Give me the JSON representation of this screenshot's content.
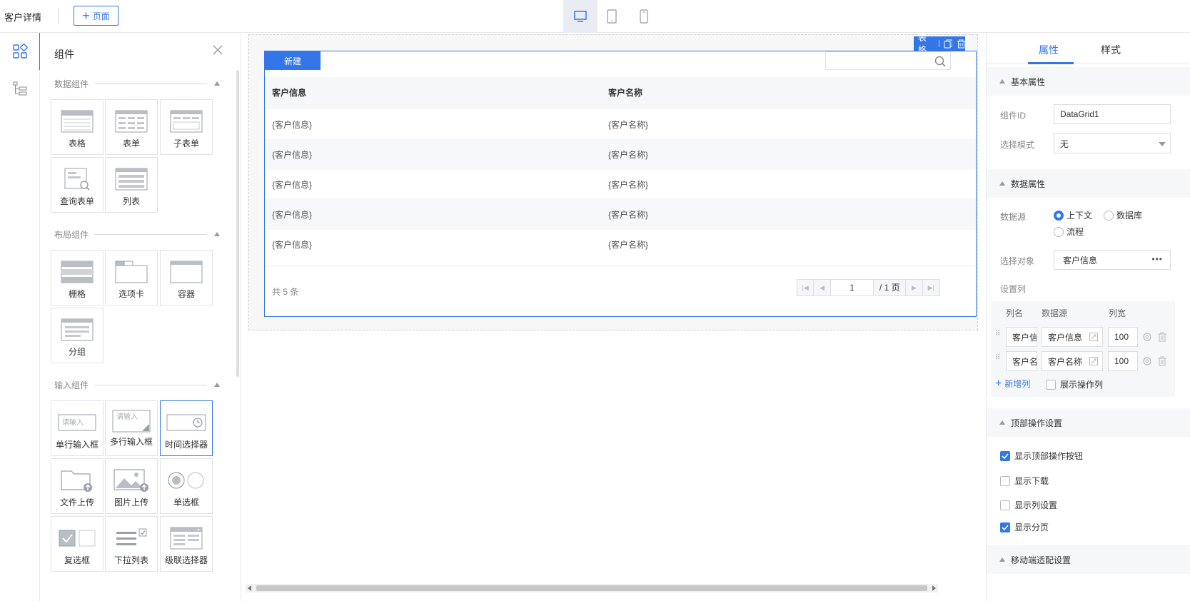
{
  "topbar": {
    "page_title": "客户详情",
    "add_page_label": "页面",
    "devices": [
      "desktop-icon",
      "tablet-icon",
      "mobile-icon"
    ]
  },
  "library": {
    "title": "组件",
    "sections": [
      {
        "title": "数据组件",
        "items": [
          "表格",
          "表单",
          "子表单",
          "查询表单",
          "列表"
        ]
      },
      {
        "title": "布局组件",
        "items": [
          "栅格",
          "选项卡",
          "容器",
          "分组"
        ]
      },
      {
        "title": "输入组件",
        "items": [
          "单行输入框",
          "多行输入框",
          "时间选择器",
          "文件上传",
          "图片上传",
          "单选框",
          "复选框",
          "下拉列表",
          "级联选择器"
        ]
      }
    ],
    "input_placeholder": "请输入",
    "textarea_placeholder": "请输入"
  },
  "canvas": {
    "grid_tag": "表格",
    "new_button": "新建",
    "columns": [
      "客户信息",
      "客户名称"
    ],
    "rows": [
      [
        "{客户信息}",
        "{客户名称}"
      ],
      [
        "{客户信息}",
        "{客户名称}"
      ],
      [
        "{客户信息}",
        "{客户名称}"
      ],
      [
        "{客户信息}",
        "{客户名称}"
      ],
      [
        "{客户信息}",
        "{客户名称}"
      ]
    ],
    "total_text": "共 5 条",
    "page_current": "1",
    "page_total": "/ 1 页"
  },
  "panel": {
    "tabs": [
      "属性",
      "样式"
    ],
    "basic_title": "基本属性",
    "component_id_label": "组件ID",
    "component_id_value": "DataGrid1",
    "select_mode_label": "选择模式",
    "select_mode_value": "无",
    "data_title": "数据属性",
    "datasource_label": "数据源",
    "datasource_options": [
      "上下文",
      "数据库",
      "流程"
    ],
    "select_object_label": "选择对象",
    "select_object_value": "客户信息",
    "set_columns_label": "设置列",
    "col_headers": [
      "列名",
      "数据源",
      "列宽"
    ],
    "columns": [
      {
        "name": "客户信息",
        "source": "客户信息",
        "width": "100"
      },
      {
        "name": "客户名称",
        "source": "客户名称",
        "width": "100"
      }
    ],
    "add_column": "新增列",
    "show_action_column": "展示操作列",
    "top_actions_title": "顶部操作设置",
    "opt_show_top_buttons": "显示顶部操作按钮",
    "opt_show_download": "显示下载",
    "opt_show_column_settings": "显示列设置",
    "opt_show_pagination": "显示分页",
    "mobile_title": "移动端适配设置",
    "accent": "#3476e8"
  }
}
